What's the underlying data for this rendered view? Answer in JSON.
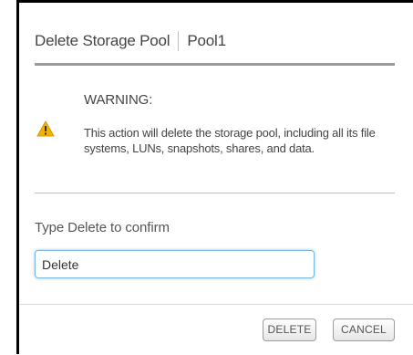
{
  "dialog": {
    "title": "Delete Storage Pool",
    "pool_name": "Pool1"
  },
  "warning": {
    "heading": "WARNING:",
    "icon": "warning-triangle-icon",
    "icon_color": "#f0b400",
    "message": "This action will delete the storage pool, including all its file systems, LUNs, snapshots, shares, and data."
  },
  "confirm": {
    "label": "Type Delete to confirm",
    "value": "Delete"
  },
  "buttons": {
    "delete_label": "DELETE",
    "cancel_label": "CANCEL"
  }
}
